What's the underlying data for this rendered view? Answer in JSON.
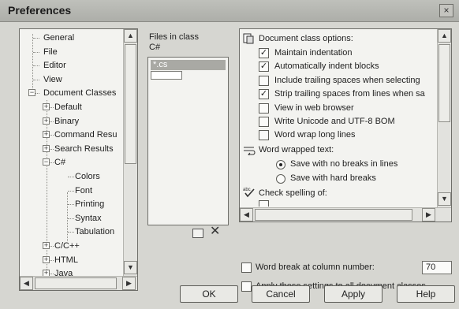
{
  "window": {
    "title": "Preferences",
    "close_glyph": "×"
  },
  "tree": {
    "items": [
      {
        "label": "General",
        "level": 1,
        "expander": ""
      },
      {
        "label": "File",
        "level": 1,
        "expander": ""
      },
      {
        "label": "Editor",
        "level": 1,
        "expander": ""
      },
      {
        "label": "View",
        "level": 1,
        "expander": ""
      },
      {
        "label": "Document Classes",
        "level": 1,
        "expander": "−"
      },
      {
        "label": "Default",
        "level": 2,
        "expander": "+"
      },
      {
        "label": "Binary",
        "level": 2,
        "expander": "+"
      },
      {
        "label": "Command Resu",
        "level": 2,
        "expander": "+"
      },
      {
        "label": "Search Results",
        "level": 2,
        "expander": "+"
      },
      {
        "label": "C#",
        "level": 2,
        "expander": "−"
      },
      {
        "label": "Colors",
        "level": 3,
        "expander": ""
      },
      {
        "label": "Font",
        "level": 3,
        "expander": ""
      },
      {
        "label": "Printing",
        "level": 3,
        "expander": ""
      },
      {
        "label": "Syntax",
        "level": 3,
        "expander": ""
      },
      {
        "label": "Tabulation",
        "level": 3,
        "expander": ""
      },
      {
        "label": "C/C++",
        "level": 2,
        "expander": "+"
      },
      {
        "label": "HTML",
        "level": 2,
        "expander": "+"
      },
      {
        "label": "Java",
        "level": 2,
        "expander": "+"
      }
    ],
    "scroll_glyphs": {
      "up": "▲",
      "down": "▼",
      "left": "◀",
      "right": "▶"
    }
  },
  "files": {
    "label_line1": "Files in class",
    "label_line2": "C#",
    "items": [
      "*.cs"
    ],
    "add_icon": "new-file-icon",
    "delete_glyph": "✕"
  },
  "options": {
    "header": "Document class options:",
    "checkboxes": [
      {
        "label": "Maintain indentation",
        "checked": true
      },
      {
        "label": "Automatically indent blocks",
        "checked": true
      },
      {
        "label": "Include trailing spaces when selecting",
        "checked": false
      },
      {
        "label": "Strip trailing spaces from lines when sa",
        "checked": true
      },
      {
        "label": "View in web browser",
        "checked": false
      },
      {
        "label": "Write Unicode and UTF-8 BOM",
        "checked": false
      },
      {
        "label": "Word wrap long lines",
        "checked": false
      }
    ],
    "wrapped_header": "Word wrapped text:",
    "radios": [
      {
        "label": "Save with no breaks in lines",
        "selected": true
      },
      {
        "label": "Save with hard breaks",
        "selected": false
      }
    ],
    "spelling_header": "Check spelling of:"
  },
  "word_break": {
    "label": "Word break at column number:",
    "checked": false,
    "value": "70"
  },
  "apply_all": {
    "label": "Apply these settings to all document classes",
    "checked": false
  },
  "buttons": {
    "ok": "OK",
    "cancel": "Cancel",
    "apply": "Apply",
    "help": "Help"
  },
  "check_glyph": "✓"
}
